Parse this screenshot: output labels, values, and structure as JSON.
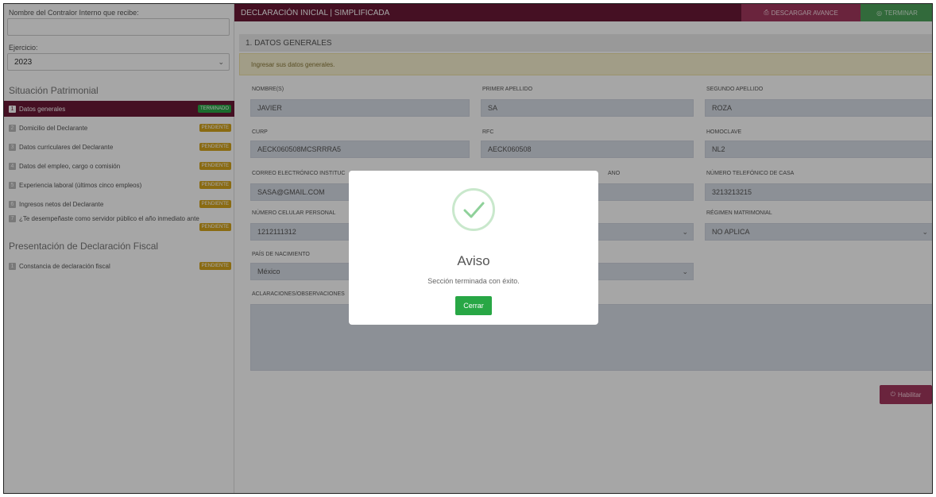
{
  "sidebar": {
    "receiver_label": "Nombre del Contralor Interno que recibe:",
    "ejercicio_label": "Ejercicio:",
    "ejercicio_value": "2023",
    "heading_patrimonial": "Situación Patrimonial",
    "heading_fiscal": "Presentación de Declaración Fiscal",
    "items": [
      {
        "num": "1",
        "label": "Datos generales",
        "status": "TERMINADO"
      },
      {
        "num": "2",
        "label": "Domicilio del Declarante",
        "status": "PENDIENTE"
      },
      {
        "num": "3",
        "label": "Datos curriculares del Declarante",
        "status": "PENDIENTE"
      },
      {
        "num": "4",
        "label": "Datos del empleo, cargo o comisión",
        "status": "PENDIENTE"
      },
      {
        "num": "5",
        "label": "Experiencia laboral (últimos cinco empleos)",
        "status": "PENDIENTE"
      },
      {
        "num": "6",
        "label": "Ingresos netos del Declarante",
        "status": "PENDIENTE"
      },
      {
        "num": "7",
        "label": "¿Te desempeñaste como servidor público el año inmediato anterior?",
        "status": "PENDIENTE"
      }
    ],
    "fiscal_items": [
      {
        "num": "1",
        "label": "Constancia de declaración fiscal",
        "status": "PENDIENTE"
      }
    ]
  },
  "topbar": {
    "title": "DECLARACIÓN INICIAL | SIMPLIFICADA",
    "descargar_label": "DESCARGAR AVANCE",
    "terminar_label": "TERMINAR"
  },
  "main": {
    "section_title": "1. DATOS GENERALES",
    "alert_text": "Ingresar sus datos generales.",
    "fields": {
      "nombre": {
        "label": "NOMBRE(S)",
        "value": "JAVIER"
      },
      "primer_apellido": {
        "label": "PRIMER APELLIDO",
        "value": "SA"
      },
      "segundo_apellido": {
        "label": "SEGUNDO APELLIDO",
        "value": "ROZA"
      },
      "curp": {
        "label": "CURP",
        "value": "AECK060508MCSRRRA5"
      },
      "rfc": {
        "label": "RFC",
        "value": "AECK060508"
      },
      "homoclave": {
        "label": "HOMOCLAVE",
        "value": "NL2"
      },
      "correo": {
        "label": "CORREO ELECTRÓNICO INSTITUC",
        "value": "SASA@GMAIL.COM"
      },
      "correo_personal": {
        "label": "ANO"
      },
      "telefono_casa": {
        "label": "NÚMERO TELEFÓNICO DE CASA",
        "value": "3213213215"
      },
      "celular": {
        "label": "NÚMERO CELULAR PERSONAL",
        "value": "1212111312"
      },
      "regimen": {
        "label": "RÉGIMEN MATRIMONIAL",
        "value": "NO APLICA"
      },
      "pais": {
        "label": "PAÍS DE NACIMIENTO",
        "value": "México"
      },
      "aclaraciones": {
        "label": "ACLARACIONES/OBSERVACIONES"
      }
    },
    "habilitar_label": "Habilitar"
  },
  "modal": {
    "title": "Aviso",
    "message": "Sección terminada con éxito.",
    "close_label": "Cerrar"
  },
  "colors": {
    "brand": "#6b1a37",
    "success": "#28a745",
    "pending": "#d4a51c"
  }
}
